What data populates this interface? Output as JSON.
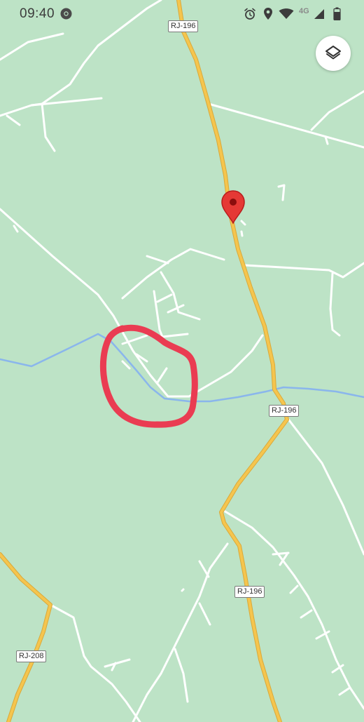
{
  "status_bar": {
    "time": "09:40",
    "network": "4G",
    "icons": [
      "chrome-icon",
      "alarm-icon",
      "location-icon",
      "wifi-icon",
      "signal-icon",
      "battery-icon"
    ]
  },
  "map": {
    "road_labels": [
      "RJ-196",
      "RJ-196",
      "RJ-196",
      "RJ-208"
    ],
    "colors": {
      "land": "#bde3c6",
      "highway": "#f5c54e",
      "highway_casing": "#d9a93a",
      "minor_road": "#ffffff",
      "river": "#8ab6ec",
      "pin": "#e53935",
      "annotation": "#ea3c52"
    }
  },
  "controls": {
    "layers_button_icon": "layers-icon"
  },
  "marker": {
    "icon": "map-pin-icon"
  },
  "annotation": {
    "shape": "hand-drawn red circle"
  }
}
